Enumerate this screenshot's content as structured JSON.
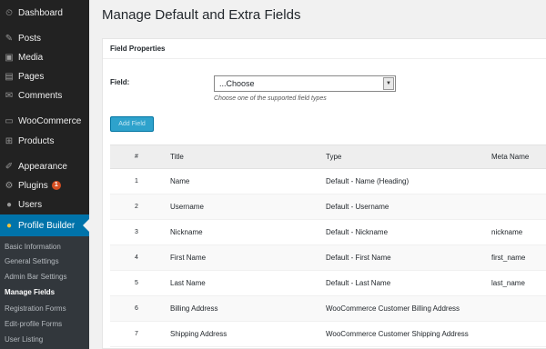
{
  "sidebar": {
    "items": [
      {
        "label": "Dashboard",
        "icon": "dashboard-icon",
        "glyph": "⏲"
      },
      {
        "label": "Posts",
        "icon": "pin-icon",
        "glyph": "✎"
      },
      {
        "label": "Media",
        "icon": "media-icon",
        "glyph": "▣"
      },
      {
        "label": "Pages",
        "icon": "pages-icon",
        "glyph": "▤"
      },
      {
        "label": "Comments",
        "icon": "comments-icon",
        "glyph": "✉"
      },
      {
        "label": "WooCommerce",
        "icon": "woocommerce-icon",
        "glyph": "▭"
      },
      {
        "label": "Products",
        "icon": "cart-icon",
        "glyph": "⊞"
      },
      {
        "label": "Appearance",
        "icon": "brush-icon",
        "glyph": "✐"
      },
      {
        "label": "Plugins",
        "icon": "plugin-icon",
        "glyph": "⚙",
        "badge": "1"
      },
      {
        "label": "Users",
        "icon": "user-icon",
        "glyph": "●"
      },
      {
        "label": "Profile Builder",
        "icon": "profile-icon",
        "glyph": "●"
      }
    ],
    "submenu": [
      {
        "label": "Basic Information"
      },
      {
        "label": "General Settings"
      },
      {
        "label": "Admin Bar Settings"
      },
      {
        "label": "Manage Fields"
      },
      {
        "label": "Registration Forms"
      },
      {
        "label": "Edit-profile Forms"
      },
      {
        "label": "User Listing"
      }
    ]
  },
  "page": {
    "title": "Manage Default and Extra Fields"
  },
  "panel": {
    "header": "Field Properties",
    "field_label": "Field:",
    "select_value": "...Choose",
    "hint": "Choose one of the supported field types",
    "add_button": "Add Field"
  },
  "table": {
    "headers": {
      "num": "#",
      "title": "Title",
      "type": "Type",
      "meta": "Meta Name"
    },
    "rows": [
      {
        "num": "1",
        "title": "Name",
        "type": "Default - Name (Heading)",
        "meta": ""
      },
      {
        "num": "2",
        "title": "Username",
        "type": "Default - Username",
        "meta": ""
      },
      {
        "num": "3",
        "title": "Nickname",
        "type": "Default - Nickname",
        "meta": "nickname"
      },
      {
        "num": "4",
        "title": "First Name",
        "type": "Default - First Name",
        "meta": "first_name"
      },
      {
        "num": "5",
        "title": "Last Name",
        "type": "Default - Last Name",
        "meta": "last_name"
      },
      {
        "num": "6",
        "title": "Billing Address",
        "type": "WooCommerce Customer Billing Address",
        "meta": ""
      },
      {
        "num": "7",
        "title": "Shipping Address",
        "type": "WooCommerce Customer Shipping Address",
        "meta": ""
      }
    ]
  },
  "colors": {
    "sidebar_bg": "#222222",
    "submenu_bg": "#32373c",
    "active_bg": "#0073aa",
    "button_bg": "#2ea2cc",
    "badge_bg": "#d54e21"
  }
}
